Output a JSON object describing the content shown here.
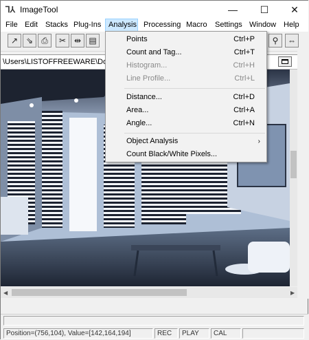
{
  "window": {
    "title": "ImageTool",
    "icon": "imagetool-app-icon",
    "minimize": "—",
    "maximize": "☐",
    "close": "✕"
  },
  "menubar": [
    "File",
    "Edit",
    "Stacks",
    "Plug-Ins",
    "Analysis",
    "Processing",
    "Macro",
    "Settings",
    "Window",
    "Help"
  ],
  "active_menu": "Analysis",
  "toolbar": {
    "icons": [
      "open-icon",
      "save-icon",
      "print-icon",
      "cut-icon",
      "copy-icon",
      "paste-icon",
      "zoom-icon",
      "pan-icon"
    ]
  },
  "document": {
    "path": "\\Users\\LISTOFFREEWARE\\Downl"
  },
  "analysis_menu": [
    {
      "label": "Points",
      "shortcut": "Ctrl+P",
      "enabled": true
    },
    {
      "label": "Count and Tag...",
      "shortcut": "Ctrl+T",
      "enabled": true
    },
    {
      "label": "Histogram...",
      "shortcut": "Ctrl+H",
      "enabled": false
    },
    {
      "label": "Line Profile...",
      "shortcut": "Ctrl+L",
      "enabled": false
    },
    {
      "label": "Distance...",
      "shortcut": "Ctrl+D",
      "enabled": true
    },
    {
      "label": "Area...",
      "shortcut": "Ctrl+A",
      "enabled": true
    },
    {
      "label": "Angle...",
      "shortcut": "Ctrl+N",
      "enabled": true
    },
    {
      "label": "Object Analysis",
      "shortcut": "›",
      "enabled": true
    },
    {
      "label": "Count Black/White Pixels...",
      "shortcut": "",
      "enabled": true
    }
  ],
  "status": {
    "position": "Position=(756,104), Value=[142,164,194]",
    "rec": "REC",
    "play": "PLAY",
    "cal": "CAL"
  },
  "colors": {
    "menu_highlight": "#cce8ff",
    "image_tint": "#aebfd6"
  }
}
